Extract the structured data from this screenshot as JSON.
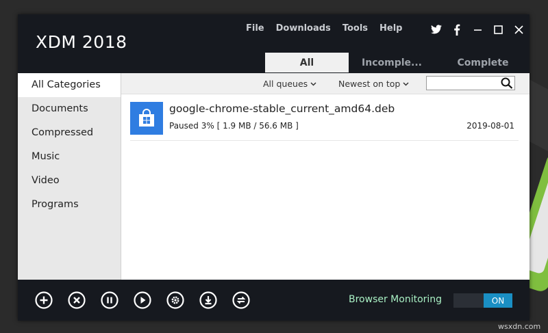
{
  "app": {
    "title": "XDM 2018"
  },
  "menu": {
    "items": [
      "File",
      "Downloads",
      "Tools",
      "Help"
    ]
  },
  "window_controls": [
    "twitter-icon",
    "facebook-icon",
    "minimize-icon",
    "maximize-icon",
    "close-icon"
  ],
  "tabs": [
    {
      "label": "All",
      "active": true
    },
    {
      "label": "Incomple...",
      "active": false
    },
    {
      "label": "Complete",
      "active": false
    }
  ],
  "sidebar": {
    "items": [
      {
        "label": "All Categories",
        "active": true
      },
      {
        "label": "Documents"
      },
      {
        "label": "Compressed"
      },
      {
        "label": "Music"
      },
      {
        "label": "Video"
      },
      {
        "label": "Programs"
      }
    ]
  },
  "toolbar": {
    "queue_filter": "All queues",
    "sort_order": "Newest on top",
    "search": {
      "value": "",
      "placeholder": ""
    }
  },
  "downloads": [
    {
      "name": "google-chrome-stable_current_amd64.deb",
      "status": "Paused 3% [ 1.9 MB / 56.6 MB ]",
      "date": "2019-08-01",
      "icon": "store-bag-icon"
    }
  ],
  "bottom": {
    "buttons": [
      "add-icon",
      "cancel-icon",
      "pause-icon",
      "play-icon",
      "settings-icon",
      "download-icon",
      "switch-icon"
    ],
    "browser_monitoring_label": "Browser Monitoring",
    "browser_monitoring_state": "ON"
  },
  "colors": {
    "window_bg": "#16191f",
    "accent": "#2f7de1",
    "toggle_on": "#1a8fc4",
    "monitor_label": "#a9f0c4"
  },
  "watermark": "wsxdn.com"
}
